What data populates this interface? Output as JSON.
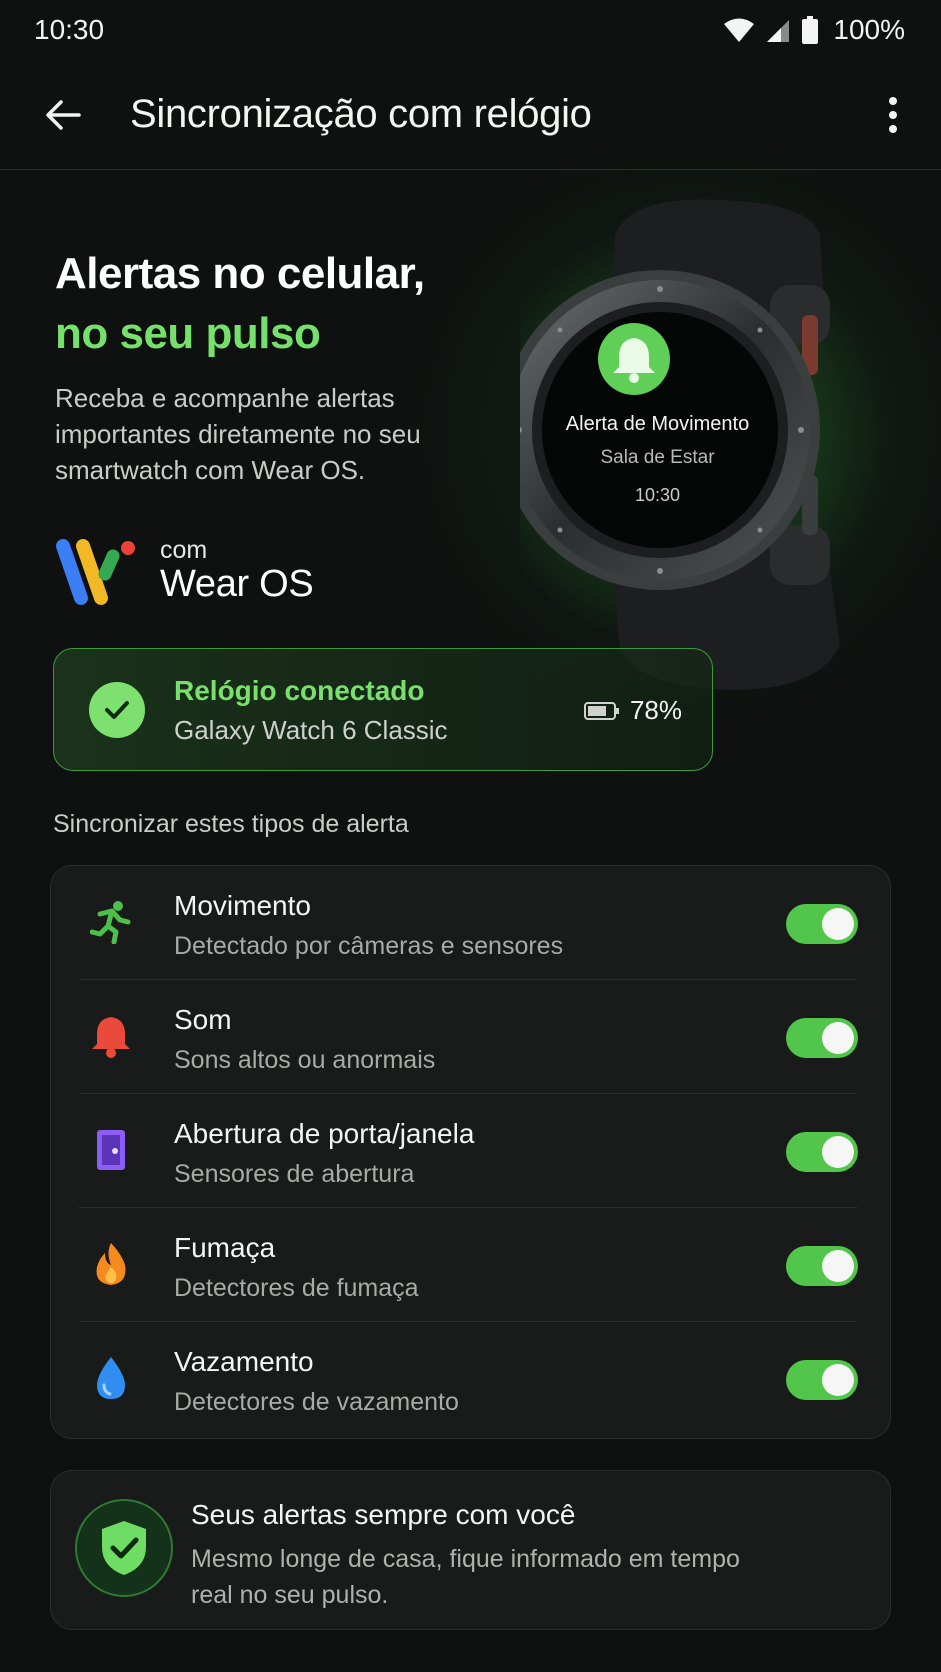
{
  "status_bar": {
    "time": "10:30",
    "battery": "100%"
  },
  "app_bar": {
    "title": "Sincronização com relógio"
  },
  "hero": {
    "title_line1": "Alertas no celular,",
    "title_line2": "no seu pulso",
    "description": "Receba e acompanhe alertas importantes diretamente no seu smartwatch com Wear OS."
  },
  "wear_os": {
    "prefix": "com",
    "name": "Wear OS"
  },
  "watch_screen": {
    "title": "Alerta de Movimento",
    "location": "Sala de Estar",
    "time": "10:30"
  },
  "connection": {
    "title": "Relógio conectado",
    "device": "Galaxy Watch 6 Classic",
    "battery": "78%"
  },
  "section_label": "Sincronizar estes tipos de alerta",
  "alerts": [
    {
      "title": "Movimento",
      "subtitle": "Detectado por câmeras e sensores",
      "icon": "running-person-icon",
      "color": "#4cc04a",
      "enabled": true
    },
    {
      "title": "Som",
      "subtitle": "Sons altos ou anormais",
      "icon": "bell-icon",
      "color": "#ea4a3c",
      "enabled": true
    },
    {
      "title": "Abertura de porta/janela",
      "subtitle": "Sensores de abertura",
      "icon": "door-icon",
      "color": "#8b5cf6",
      "enabled": true
    },
    {
      "title": "Fumaça",
      "subtitle": "Detectores de fumaça",
      "icon": "flame-icon",
      "color": "#f58a1f",
      "enabled": true
    },
    {
      "title": "Vazamento",
      "subtitle": "Detectores de vazamento",
      "icon": "water-drop-icon",
      "color": "#2f8ef0",
      "enabled": true
    }
  ],
  "info_card": {
    "title": "Seus alertas sempre com você",
    "description": "Mesmo longe de casa, fique informado em tempo real no seu pulso."
  },
  "colors": {
    "accent": "#76e06d",
    "toggle_on": "#52c64a",
    "background": "#0e1110"
  }
}
